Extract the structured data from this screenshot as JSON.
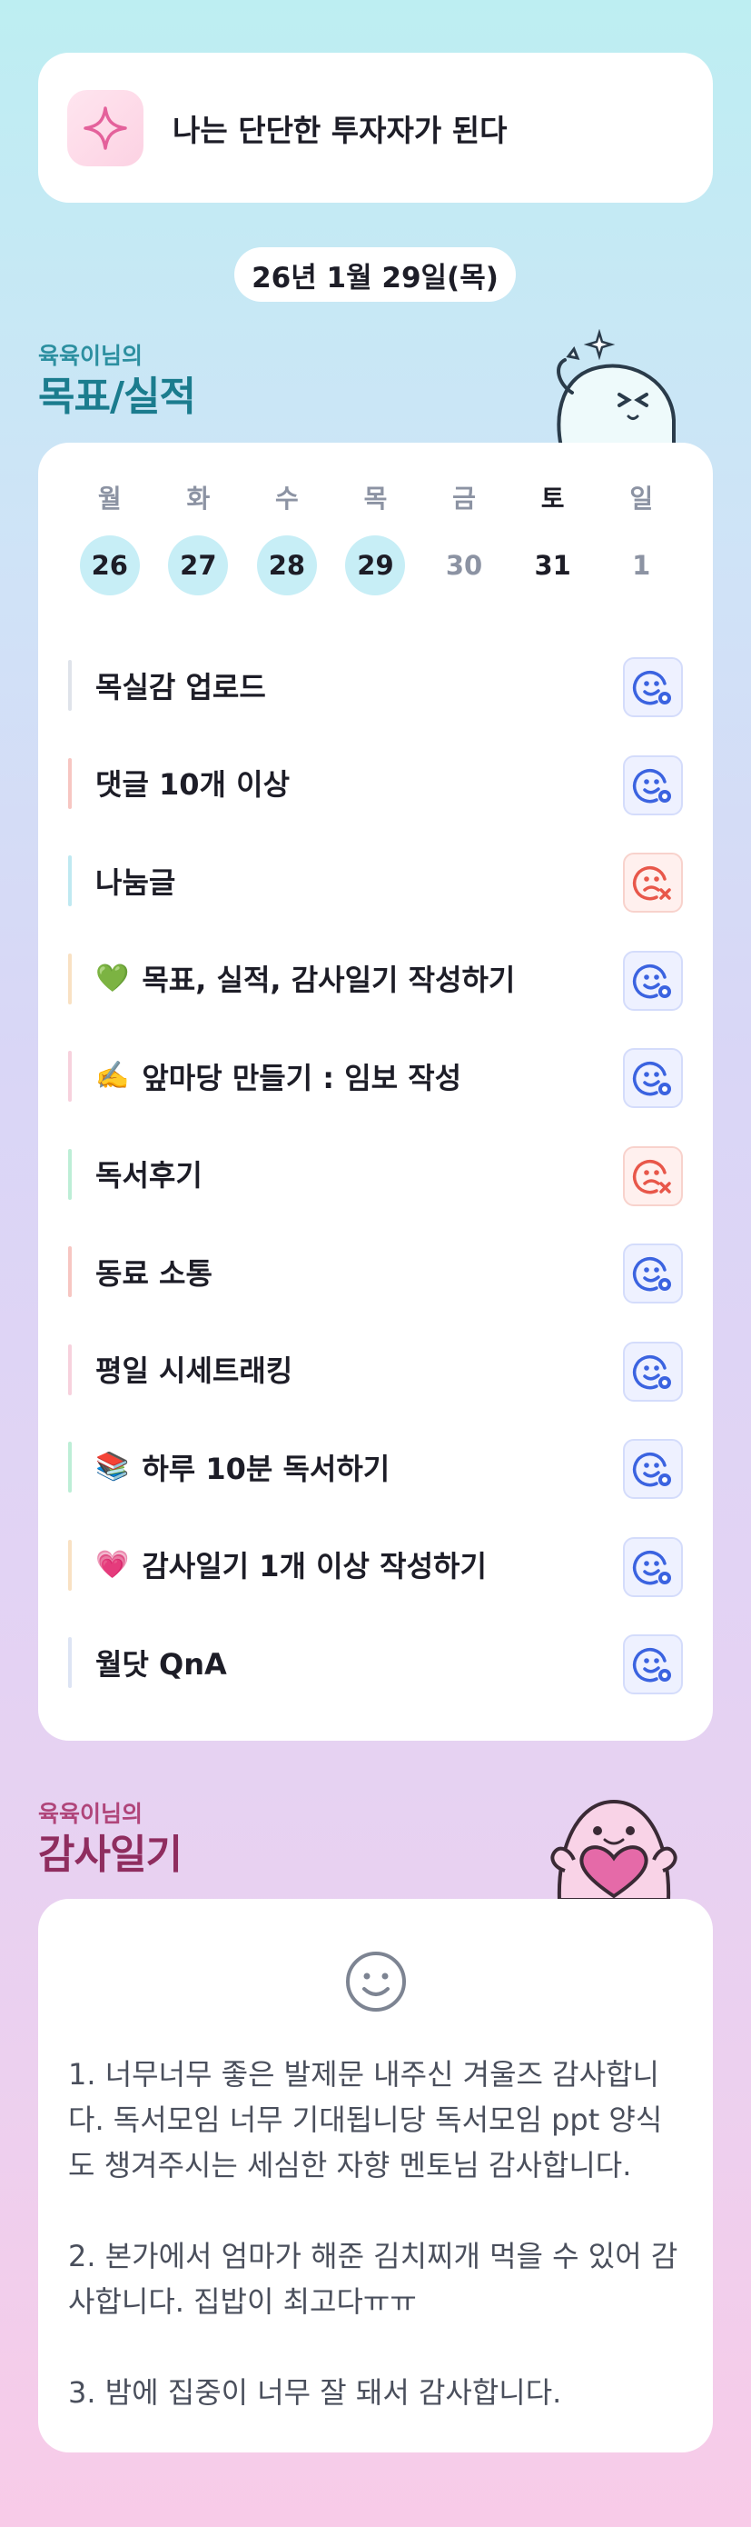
{
  "goal": {
    "text": "나는 단단한 투자자가 된다",
    "icon": "sparkle-icon",
    "color": "#e4619b"
  },
  "date": "26년 1월 29일(목)",
  "goals_section": {
    "subtitle": "육육이님의",
    "title": "목표/실적",
    "subtitle_color": "#2c8fa0",
    "title_color": "#1b7c8e"
  },
  "week": {
    "days": [
      "월",
      "화",
      "수",
      "목",
      "금",
      "토",
      "일"
    ],
    "dates": [
      "26",
      "27",
      "28",
      "29",
      "30",
      "31",
      "1"
    ],
    "completed_count": 4
  },
  "tasks": [
    {
      "label": "목실감 업로드",
      "emoji": "",
      "status": "done",
      "bar_color": "#dfe3ea"
    },
    {
      "label": "댓글 10개 이상",
      "emoji": "",
      "status": "done",
      "bar_color": "#f7c6c2"
    },
    {
      "label": "나눔글",
      "emoji": "",
      "status": "failed",
      "bar_color": "#bfe9f1"
    },
    {
      "label": "목표, 실적, 감사일기 작성하기",
      "emoji": "💚",
      "status": "done",
      "bar_color": "#f9e1c3"
    },
    {
      "label": "앞마당 만들기 : 임보 작성",
      "emoji": "✍️",
      "status": "done",
      "bar_color": "#f7d1dd"
    },
    {
      "label": "독서후기",
      "emoji": "",
      "status": "failed",
      "bar_color": "#bdeed6"
    },
    {
      "label": "동료 소통",
      "emoji": "",
      "status": "done",
      "bar_color": "#f7c6c2"
    },
    {
      "label": "평일 시세트래킹",
      "emoji": "",
      "status": "done",
      "bar_color": "#f7d1dd"
    },
    {
      "label": "하루 10분 독서하기",
      "emoji": "📚",
      "status": "done",
      "bar_color": "#bdeed6"
    },
    {
      "label": "감사일기 1개 이상 작성하기",
      "emoji": "💗",
      "status": "done",
      "bar_color": "#f9e1c3"
    },
    {
      "label": "월닷 QnA",
      "emoji": "",
      "status": "done",
      "bar_color": "#dde4f4"
    }
  ],
  "diary_section": {
    "subtitle": "육육이님의",
    "title": "감사일기",
    "subtitle_color": "#b0457a",
    "title_color": "#8f2d5f"
  },
  "diary": {
    "icon": "smile-icon",
    "text": "1. 너무너무 좋은 발제문 내주신 겨울즈 감사합니다. 독서모임 너무 기대됩니당 독서모임 ppt 양식도 챙겨주시는 세심한 자향 멘토님 감사합니다.\n\n2. 본가에서 엄마가 해준 김치찌개 먹을 수 있어 감사합니다. 집밥이 최고다ㅠㅠ\n\n3. 밤에 집중이 너무 잘 돼서 감사합니다."
  }
}
